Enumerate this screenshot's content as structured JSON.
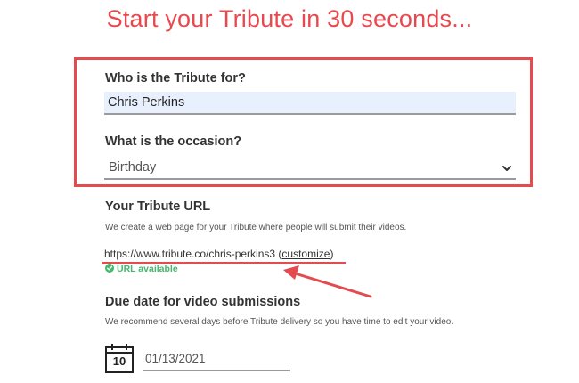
{
  "page": {
    "title": "Start your Tribute in 30 seconds..."
  },
  "form": {
    "recipient": {
      "label": "Who is the Tribute for?",
      "value": "Chris Perkins"
    },
    "occasion": {
      "label": "What is the occasion?",
      "value": "Birthday"
    },
    "url": {
      "label": "Your Tribute URL",
      "help": "We create a web page for your Tribute where people will submit their videos.",
      "value": "https://www.tribute.co/chris-perkins3",
      "customize_label": "customize",
      "status": "URL available"
    },
    "due_date": {
      "label": "Due date for video submissions",
      "help": "We recommend several days before Tribute delivery so you have time to edit your video.",
      "calendar_day": "10",
      "value": "01/13/2021"
    }
  },
  "colors": {
    "title": "#e8494e",
    "highlight": "#e34b4f",
    "available": "#43b86e",
    "input_fill": "#e8f0fe"
  },
  "icons": [
    "chevron-down-icon",
    "check-circle-icon",
    "calendar-icon",
    "annotation-arrow"
  ]
}
